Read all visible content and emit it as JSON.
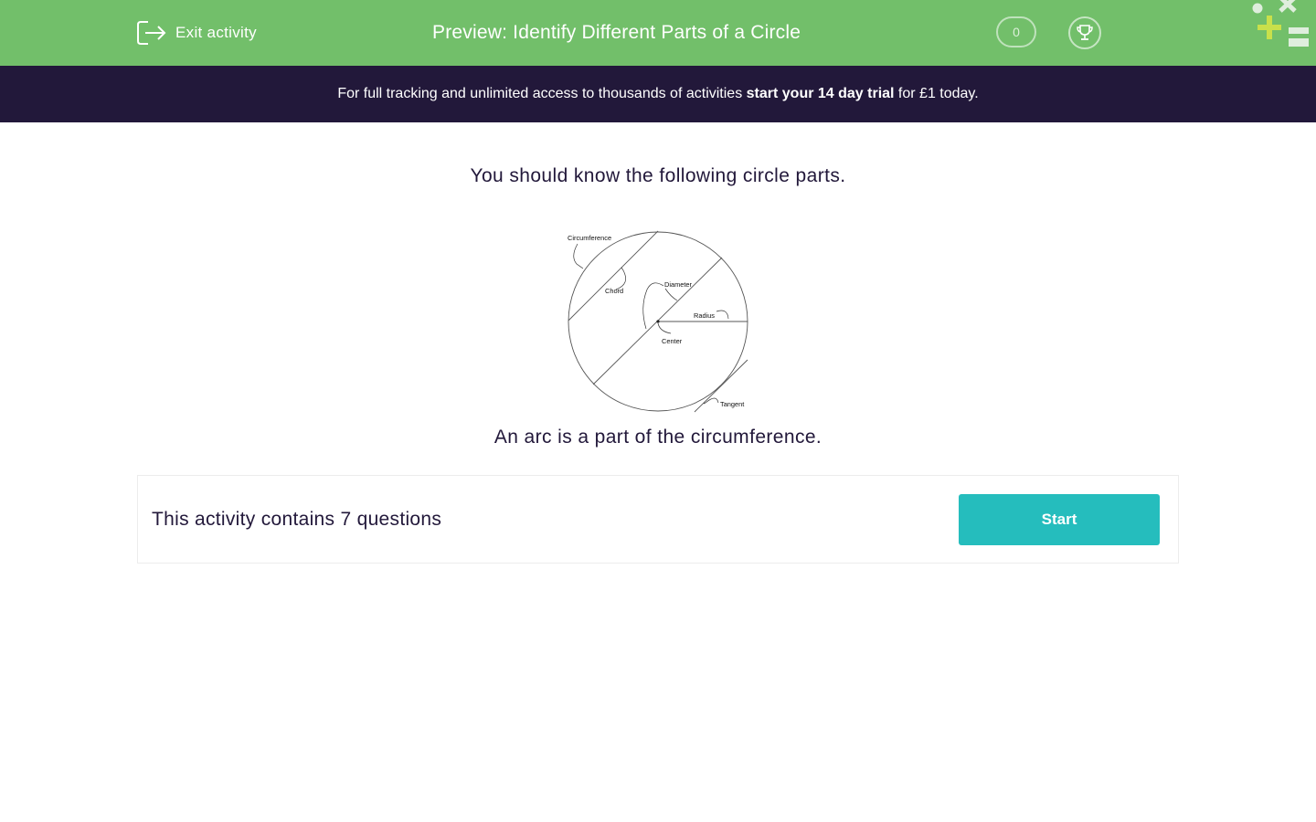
{
  "header": {
    "exit_label": "Exit activity",
    "title": "Preview: Identify Different Parts of a Circle",
    "score": "0"
  },
  "banner": {
    "text_before": "For full tracking and unlimited access to thousands of activities ",
    "cta": "start your 14 day trial",
    "text_after": " for £1 today."
  },
  "content": {
    "intro": "You should know the following circle parts.",
    "arc_note": "An arc is a part of the circumference."
  },
  "diagram": {
    "labels": {
      "circumference": "Circumference",
      "chord": "Chord",
      "diameter": "Diameter",
      "radius": "Radius",
      "center": "Center",
      "tangent": "Tangent"
    }
  },
  "activity_card": {
    "text": "This activity contains 7 questions",
    "start_label": "Start"
  },
  "colors": {
    "header_bg": "#72bf6a",
    "banner_bg": "#22183a",
    "start_button": "#25bdbd",
    "text_dark": "#22183a"
  }
}
